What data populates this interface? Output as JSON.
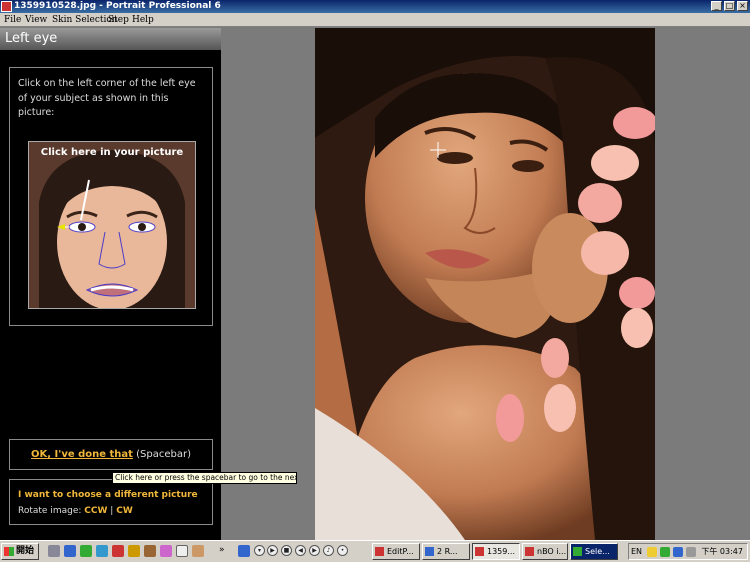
{
  "window": {
    "title": "1359910528.jpg - Portrait Professional 6",
    "controls": [
      "_",
      "□",
      "×"
    ]
  },
  "menu": [
    "File",
    "View",
    "Skin Selection",
    "Step",
    "Help"
  ],
  "panel": {
    "header": "Left eye",
    "instruction": "Click on the left corner of the left eye of your subject as shown in this picture:",
    "sample_caption": "Click here in your picture",
    "done_link": "OK, I've done that",
    "done_key": "(Spacebar)",
    "tooltip": "Click here or press the spacebar to go to the next step",
    "choose_link": "I want to choose a different picture",
    "rotate_label": "Rotate image:",
    "rotate_ccw": "CCW",
    "rotate_sep": "|",
    "rotate_cw": "CW"
  },
  "taskbar": {
    "start": "開始",
    "tasks": [
      "EditP...",
      "2 R...",
      "1359...",
      "nBO i...",
      "Sele..."
    ],
    "lang": "EN",
    "clock": "下午 03:47",
    "more": "»"
  },
  "colors": {
    "accent_link": "#f0b73a",
    "panel_bg": "#000000",
    "workspace_bg": "#7b7b7b",
    "titlebar": "#0a246a"
  }
}
